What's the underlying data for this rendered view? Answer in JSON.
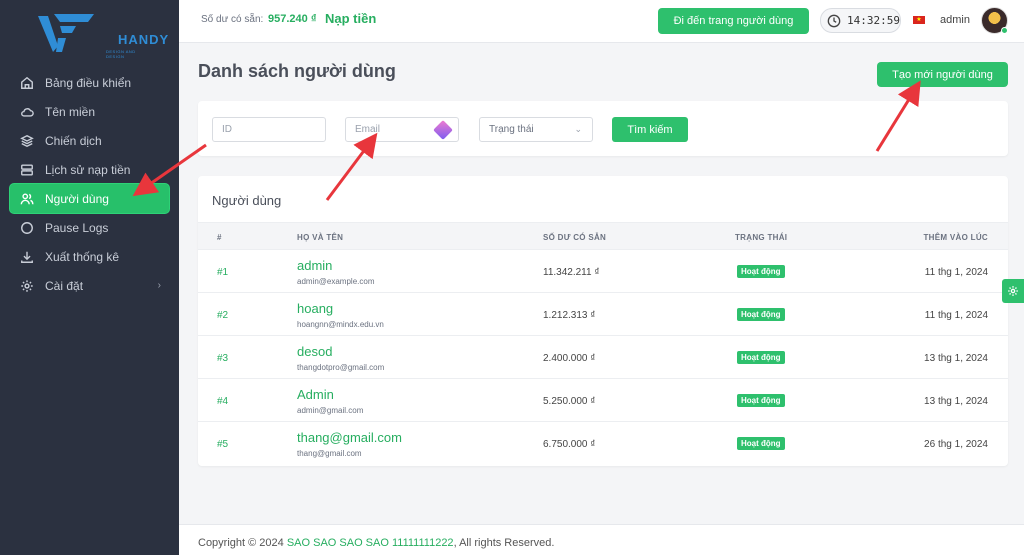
{
  "brand": {
    "name": "HANDY",
    "tagline": "DESIGN AND DESIGN"
  },
  "sidebar": {
    "items": [
      {
        "label": "Bảng điều khiển",
        "icon": "home-icon"
      },
      {
        "label": "Tên miền",
        "icon": "cloud-icon"
      },
      {
        "label": "Chiến dịch",
        "icon": "layers-icon"
      },
      {
        "label": "Lịch sử nạp tiền",
        "icon": "server-icon"
      },
      {
        "label": "Người dùng",
        "icon": "users-icon",
        "active": true
      },
      {
        "label": "Pause Logs",
        "icon": "circle-icon"
      },
      {
        "label": "Xuất thống kê",
        "icon": "download-icon"
      },
      {
        "label": "Cài đặt",
        "icon": "gear-icon",
        "chevron": "›"
      }
    ]
  },
  "header": {
    "balance_label": "Số dư có sẵn:",
    "balance_value": "957.240 ₫",
    "topup_label": "Nạp tiền",
    "goto_user_page": "Đi đến trang người dùng",
    "clock": "14:32:59",
    "username": "admin",
    "flag_star": "★"
  },
  "page": {
    "title": "Danh sách người dùng",
    "create_button": "Tạo mới người dùng"
  },
  "filters": {
    "id_placeholder": "ID",
    "email_placeholder": "Email",
    "status_select": "Trạng thái",
    "status_chevron": "⌄",
    "search_button": "Tìm kiếm"
  },
  "table": {
    "title": "Người dùng",
    "columns": [
      "#",
      "HỌ VÀ TÊN",
      "SỐ DƯ CÓ SẴN",
      "TRẠNG THÁI",
      "THÊM VÀO LÚC"
    ],
    "rows": [
      {
        "id": "#1",
        "name": "admin",
        "email": "admin@example.com",
        "balance": "11.342.211 ₫",
        "status": "Hoạt động",
        "added": "11 thg 1, 2024"
      },
      {
        "id": "#2",
        "name": "hoang",
        "email": "hoangnn@mindx.edu.vn",
        "balance": "1.212.313 ₫",
        "status": "Hoạt động",
        "added": "11 thg 1, 2024"
      },
      {
        "id": "#3",
        "name": "desod",
        "email": "thangdotpro@gmail.com",
        "balance": "2.400.000 ₫",
        "status": "Hoạt động",
        "added": "13 thg 1, 2024"
      },
      {
        "id": "#4",
        "name": "Admin",
        "email": "admin@gmail.com",
        "balance": "5.250.000 ₫",
        "status": "Hoạt động",
        "added": "13 thg 1, 2024"
      },
      {
        "id": "#5",
        "name": "thang@gmail.com",
        "email": "thang@gmail.com",
        "balance": "6.750.000 ₫",
        "status": "Hoạt động",
        "added": "26 thg 1, 2024"
      }
    ]
  },
  "footer": {
    "prefix": "Copyright © 2024 ",
    "company": "SAO SAO SAO SAO 11111111222",
    "suffix": ", All rights Reserved."
  },
  "colors": {
    "accent": "#2ec06d",
    "sidebar_bg": "#2b3140",
    "annotation_arrow": "#e8363c"
  }
}
